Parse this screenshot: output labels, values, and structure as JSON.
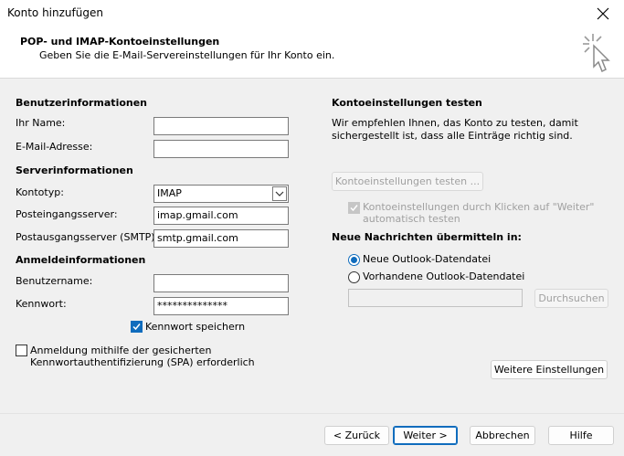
{
  "window": {
    "title": "Konto hinzufügen"
  },
  "header": {
    "title": "POP- und IMAP-Kontoeinstellungen",
    "subtitle": "Geben Sie die E-Mail-Servereinstellungen für Ihr Konto ein."
  },
  "user_info": {
    "section": "Benutzerinformationen",
    "name_label": "Ihr Name:",
    "name_value": "",
    "email_label": "E-Mail-Adresse:",
    "email_value": ""
  },
  "server_info": {
    "section": "Serverinformationen",
    "account_type_label": "Kontotyp:",
    "account_type_value": "IMAP",
    "incoming_label": "Posteingangsserver:",
    "incoming_value": "imap.gmail.com",
    "outgoing_label": "Postausgangsserver (SMTP):",
    "outgoing_value": "smtp.gmail.com"
  },
  "login_info": {
    "section": "Anmeldeinformationen",
    "username_label": "Benutzername:",
    "username_value": "",
    "password_label": "Kennwort:",
    "password_value": "**************",
    "remember_password": "Kennwort speichern",
    "spa_label_1": "Anmeldung mithilfe der gesicherten",
    "spa_label_2": "Kennwortauthentifizierung (SPA) erforderlich"
  },
  "test_settings": {
    "section": "Kontoeinstellungen testen",
    "desc_1": "Wir empfehlen Ihnen, das Konto zu testen, damit",
    "desc_2": "sichergestellt ist, dass alle Einträge richtig sind.",
    "test_button": "Kontoeinstellungen testen ...",
    "auto_test_1": "Kontoeinstellungen durch Klicken auf \"Weiter\"",
    "auto_test_2": "automatisch testen"
  },
  "deliver": {
    "section": "Neue Nachrichten übermitteln in:",
    "option_new": "Neue Outlook-Datendatei",
    "option_existing": "Vorhandene Outlook-Datendatei",
    "path_value": "",
    "browse_button": "Durchsuchen"
  },
  "more_settings_button": "Weitere Einstellungen",
  "footer": {
    "back": "< Zurück",
    "next": "Weiter >",
    "cancel": "Abbrechen",
    "help": "Hilfe"
  },
  "colors": {
    "accent": "#0f6cbd",
    "background": "#f0f0f0",
    "disabled": "#a0a0a0"
  }
}
